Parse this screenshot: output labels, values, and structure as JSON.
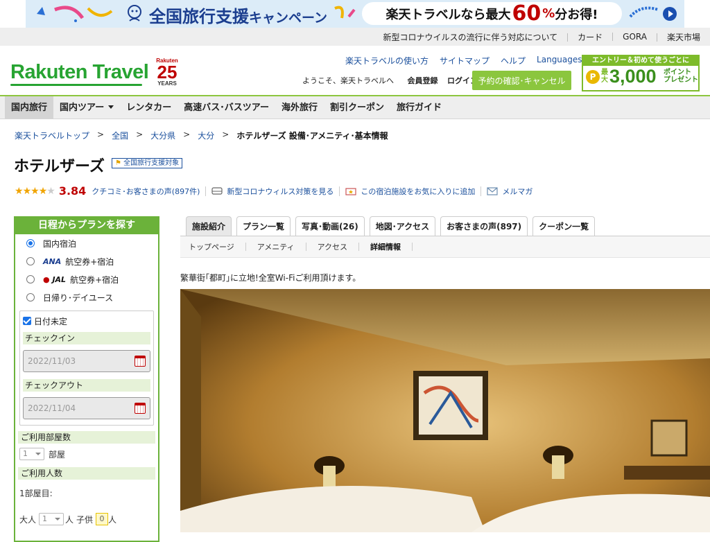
{
  "banner": {
    "title_main": "全国旅行支援",
    "title_sub": "キャンペーン",
    "pill_prefix": "楽天トラベルなら最大",
    "pill_pct": "60",
    "pill_pct_sign": "%",
    "pill_suffix": "分お得!"
  },
  "util_links": [
    "新型コロナウイルスの流行に伴う対応について",
    "カード",
    "GORA",
    "楽天市場"
  ],
  "header": {
    "logo": "Rakuten Travel",
    "anniv_brand": "Rakuten",
    "anniv_num": "25",
    "anniv_years": "YEARS",
    "links": [
      "楽天トラベルの使い方",
      "サイトマップ",
      "ヘルプ",
      "Languages"
    ],
    "welcome": "ようこそ、楽天トラベルへ",
    "register": "会員登録",
    "login": "ログイン",
    "reservation_button": "予約の確認･キャンセル",
    "promo_top": "エントリー＆初めて使うごとに",
    "promo_coin": "P",
    "promo_max": "最大",
    "promo_amount": "3,000",
    "promo_point": "ポイント",
    "promo_present": "プレゼント"
  },
  "gnav": [
    {
      "label": "国内旅行",
      "active": true
    },
    {
      "label": "国内ツアー",
      "active": false
    },
    {
      "label": "レンタカー",
      "active": false
    },
    {
      "label": "高速バス･バスツアー",
      "active": false
    },
    {
      "label": "海外旅行",
      "active": false
    },
    {
      "label": "割引クーポン",
      "active": false
    },
    {
      "label": "旅行ガイド",
      "active": false
    }
  ],
  "breadcrumb": {
    "items": [
      "楽天トラベルトップ",
      "全国",
      "大分県",
      "大分"
    ],
    "sep": ">",
    "current": "ホテルザーズ 設備･アメニティ･基本情報"
  },
  "hotel": {
    "name": "ホテルザーズ",
    "badge": "全国旅行支援対象",
    "rating_value": 3.84,
    "rating_stars": 4,
    "score": "3.84",
    "reviews_link": "クチコミ･お客さまの声(897件)",
    "covid_link": "新型コロナウィルス対策を見る",
    "favorite_link": "この宿泊施設をお気に入りに追加",
    "mail_link": "メルマガ"
  },
  "sidebar": {
    "header": "日程からプランを探す",
    "options": [
      {
        "airline": "",
        "label": "国内宿泊",
        "selected": true
      },
      {
        "airline": "ANA",
        "label": "航空券+宿泊",
        "selected": false
      },
      {
        "airline": "JAL",
        "label": "航空券+宿泊",
        "selected": false
      },
      {
        "airline": "",
        "label": "日帰り･デイユース",
        "selected": false
      }
    ],
    "date_undecided": "日付未定",
    "checkin_label": "チェックイン",
    "checkin_placeholder": "2022/11/03",
    "checkout_label": "チェックアウト",
    "checkout_placeholder": "2022/11/04",
    "rooms_label": "ご利用部屋数",
    "rooms_value": "1",
    "rooms_unit": "部屋",
    "guests_label": "ご利用人数",
    "room1_label": "1部屋目:",
    "adult_label": "大人",
    "adult_value": "1",
    "adult_unit": "人",
    "child_label": "子供",
    "child_value": "0",
    "child_unit": "人"
  },
  "tabs": [
    "施設紹介",
    "プラン一覧",
    "写真･動画(26)",
    "地図･アクセス",
    "お客さまの声(897)",
    "クーポン一覧"
  ],
  "subtabs": [
    "トップページ",
    "アメニティ",
    "アクセス",
    "詳細情報"
  ],
  "subtab_current": 3,
  "description": "繁華街｢都町｣に立地!全室Wi-Fiご利用頂けます。"
}
